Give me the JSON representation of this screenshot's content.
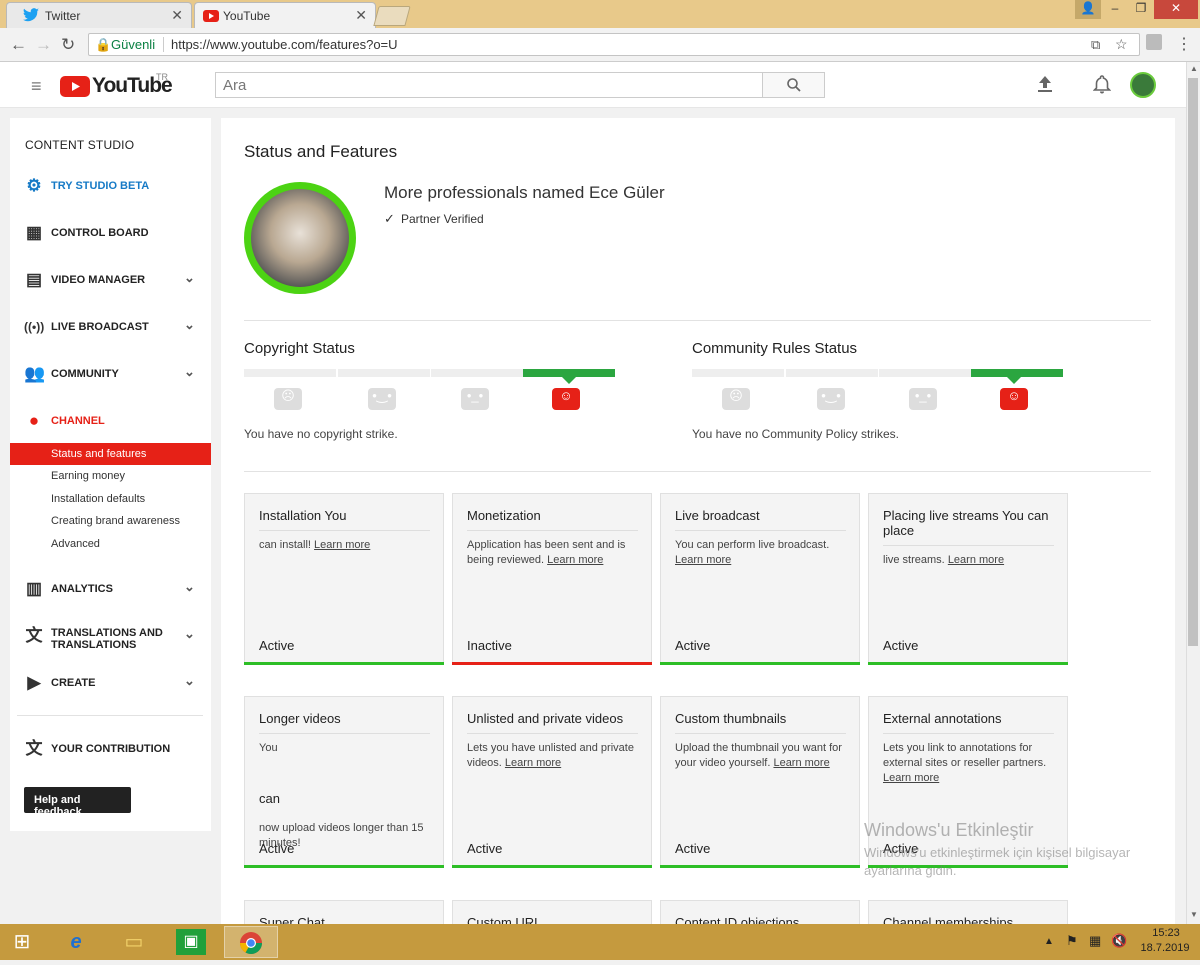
{
  "browser": {
    "tabs": [
      {
        "label": "Twitter",
        "active": false
      },
      {
        "label": "YouTube",
        "active": true
      }
    ],
    "window_controls": [
      "–",
      "❐",
      "✕"
    ],
    "secure_label": "Güvenli",
    "url": "https://www.youtube.com/features?o=U"
  },
  "youtube": {
    "logo_text": "YouTube",
    "region": "TR",
    "search_placeholder": "Ara"
  },
  "sidebar": {
    "heading": "CONTENT STUDIO",
    "items": [
      {
        "label": "TRY STUDIO BETA",
        "icon": "gear-icon"
      },
      {
        "label": "CONTROL BOARD",
        "icon": "dashboard-icon"
      },
      {
        "label": "VIDEO MANAGER",
        "icon": "video-manager-icon"
      },
      {
        "label": "LIVE BROADCAST",
        "icon": "live-icon"
      },
      {
        "label": "COMMUNITY",
        "icon": "community-icon"
      },
      {
        "label": "CHANNEL",
        "icon": "channel-icon"
      }
    ],
    "channel_sub": [
      "Status and features",
      "Earning money",
      "Installation defaults",
      "Creating brand awareness",
      "Advanced"
    ],
    "items2": [
      {
        "label": "ANALYTICS",
        "icon": "analytics-icon"
      },
      {
        "label": "TRANSLATIONS AND\nTRANSLATIONS",
        "icon": "translate-icon"
      },
      {
        "label": "CREATE",
        "icon": "create-icon"
      }
    ],
    "contribution": "YOUR CONTRIBUTION",
    "help_button": "Help and feedback"
  },
  "main": {
    "title": "Status and Features",
    "profile_name": "More professionals named Ece Güler",
    "partner_label": "Partner Verified",
    "copyright_title": "Copyright Status",
    "copyright_text": "You have no copyright strike.",
    "community_title": "Community Rules Status",
    "community_text": "You have no Community Policy strikes.",
    "learn_more": "Learn more",
    "cards": [
      {
        "title": "Installation You",
        "desc": "can install!",
        "status": "Active",
        "ok": true
      },
      {
        "title": "Monetization",
        "desc": "Application has been sent and is being reviewed.",
        "status": "Inactive",
        "ok": false
      },
      {
        "title": "Live broadcast",
        "desc": "You can perform live broadcast.",
        "status": "Active",
        "ok": true
      },
      {
        "title": "Placing live streams You can place",
        "desc": "live streams.",
        "status": "Active",
        "ok": true
      },
      {
        "title": "Longer videos",
        "desc": "You",
        "desc2": "can",
        "desc3": "now upload videos longer than 15 minutes!",
        "status": "Active",
        "ok": true
      },
      {
        "title": "Unlisted and private videos",
        "desc": "Lets you have unlisted and private videos.",
        "status": "Active",
        "ok": true
      },
      {
        "title": "Custom thumbnails",
        "desc": "Upload the thumbnail you want for your video yourself.",
        "status": "Active",
        "ok": true
      },
      {
        "title": "External annotations",
        "desc": "Lets you link to annotations for external sites or reseller partners.",
        "status": "Active",
        "ok": true
      }
    ],
    "cards_row3": [
      "Super Chat",
      "Custom URL",
      "Content ID objections",
      "Channel memberships"
    ]
  },
  "watermark": {
    "line1": "Windows'u Etkinleştir",
    "line2": "Windows'u etkinleştirmek için kişisel bilgisayar",
    "line3": "ayarlarına gidin."
  },
  "taskbar": {
    "time": "15:23",
    "date": "18.7.2019"
  },
  "colors": {
    "youtube_red": "#e62117",
    "active_green": "#2dbe26",
    "strike_green": "#2ba640"
  }
}
